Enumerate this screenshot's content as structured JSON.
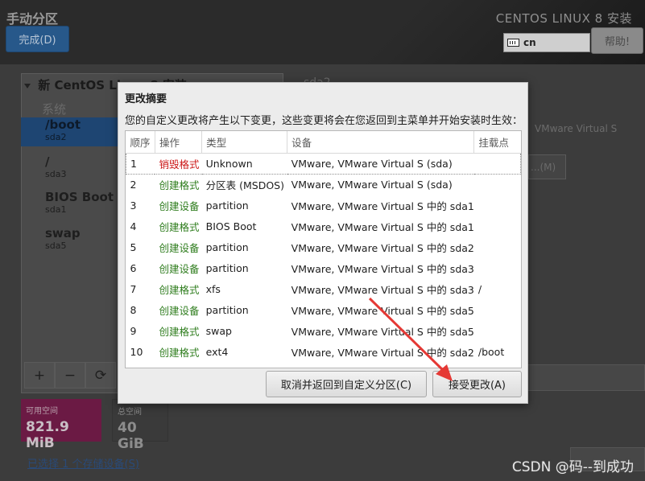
{
  "header": {
    "app_title": "手动分区",
    "done_button": "完成(D)",
    "install_title": "CENTOS LINUX 8 安装",
    "keyboard_layout": "cn",
    "help_button": "帮助!"
  },
  "left_panel": {
    "tree_title": "新 CentOS Linux 8 安装",
    "system_label": "系统",
    "partitions": [
      {
        "name": "/boot",
        "device": "sda2",
        "selected": true
      },
      {
        "name": "/",
        "device": "sda3",
        "selected": false
      },
      {
        "name": "BIOS Boot",
        "device": "sda1",
        "selected": false
      },
      {
        "name": "swap",
        "device": "sda5",
        "selected": false
      }
    ],
    "toolbar": {
      "add": "+",
      "remove": "−",
      "refresh": "⟳"
    }
  },
  "space": {
    "available_label": "可用空间",
    "available_value": "821.9 MiB",
    "total_label": "总空间",
    "total_value": "40 GiB"
  },
  "storage_link": "已选择 1 个存储设备(S)",
  "right_panel": {
    "device_name": "sda2",
    "device_desc": "VMware Virtual S",
    "modify_button": "...(M)"
  },
  "dialog": {
    "title": "更改摘要",
    "description": "您的自定义更改将产生以下变更，这些变更将会在您返回到主菜单并开始安装时生效：",
    "columns": [
      "顺序",
      "操作",
      "类型",
      "设备",
      "挂载点"
    ],
    "rows": [
      {
        "order": "1",
        "action": "销毁格式",
        "action_kind": "destroy",
        "type": "Unknown",
        "device": "VMware, VMware Virtual S (sda)",
        "mount": ""
      },
      {
        "order": "2",
        "action": "创建格式",
        "action_kind": "create",
        "type": "分区表 (MSDOS)",
        "device": "VMware, VMware Virtual S (sda)",
        "mount": ""
      },
      {
        "order": "3",
        "action": "创建设备",
        "action_kind": "create",
        "type": "partition",
        "device": "VMware, VMware Virtual S 中的 sda1",
        "mount": ""
      },
      {
        "order": "4",
        "action": "创建格式",
        "action_kind": "create",
        "type": "BIOS Boot",
        "device": "VMware, VMware Virtual S 中的 sda1",
        "mount": ""
      },
      {
        "order": "5",
        "action": "创建设备",
        "action_kind": "create",
        "type": "partition",
        "device": "VMware, VMware Virtual S 中的 sda2",
        "mount": ""
      },
      {
        "order": "6",
        "action": "创建设备",
        "action_kind": "create",
        "type": "partition",
        "device": "VMware, VMware Virtual S 中的 sda3",
        "mount": ""
      },
      {
        "order": "7",
        "action": "创建格式",
        "action_kind": "create",
        "type": "xfs",
        "device": "VMware, VMware Virtual S 中的 sda3",
        "mount": "/"
      },
      {
        "order": "8",
        "action": "创建设备",
        "action_kind": "create",
        "type": "partition",
        "device": "VMware, VMware Virtual S 中的 sda5",
        "mount": ""
      },
      {
        "order": "9",
        "action": "创建格式",
        "action_kind": "create",
        "type": "swap",
        "device": "VMware, VMware Virtual S 中的 sda5",
        "mount": ""
      },
      {
        "order": "10",
        "action": "创建格式",
        "action_kind": "create",
        "type": "ext4",
        "device": "VMware, VMware Virtual S 中的 sda2",
        "mount": "/boot"
      }
    ],
    "cancel_button": "取消并返回到自定义分区(C)",
    "accept_button": "接受更改(A)"
  },
  "watermark": "CSDN @码--到成功",
  "colors": {
    "destroy": "#cc1a1a",
    "create": "#2f7d1e",
    "annotation_arrow": "#e53935"
  }
}
